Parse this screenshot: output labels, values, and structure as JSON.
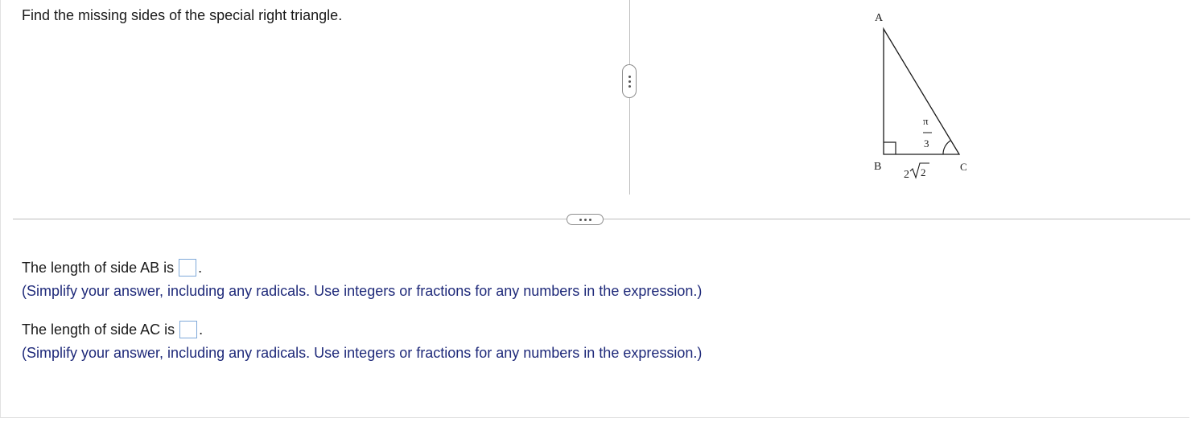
{
  "question": {
    "prompt": "Find the missing sides of the special right triangle."
  },
  "figure": {
    "vertex_a": "A",
    "vertex_b": "B",
    "vertex_c": "C",
    "angle_numerator": "π",
    "angle_denominator": "3",
    "side_bc_coefficient": "2",
    "side_bc_radicand": "2"
  },
  "answers": [
    {
      "prefix": "The length of side AB is",
      "suffix": ".",
      "value": "",
      "instruction": "(Simplify your answer, including any radicals. Use integers or fractions for any numbers in the expression.)"
    },
    {
      "prefix": "The length of side AC is",
      "suffix": ".",
      "value": "",
      "instruction": "(Simplify your answer, including any radicals. Use integers or fractions for any numbers in the expression.)"
    }
  ],
  "colors": {
    "instruction_text": "#1f2a7a",
    "answer_box_border": "#7fa9d9",
    "divider": "#bdbdbd"
  }
}
